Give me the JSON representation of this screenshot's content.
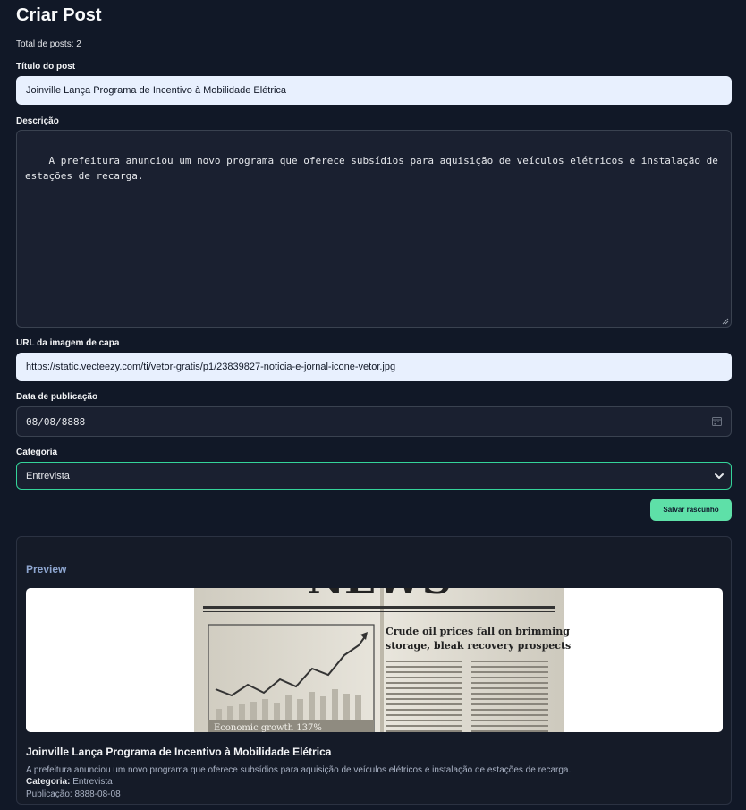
{
  "page": {
    "title": "Criar Post",
    "total_posts": "Total de posts: 2"
  },
  "form": {
    "title_label": "Título do post",
    "title_value": "Joinville Lança Programa de Incentivo à Mobilidade Elétrica",
    "description_label": "Descrição",
    "description_value": "A prefeitura anunciou um novo programa que oferece subsídios para aquisição de veículos elétricos e instalação de estações de recarga.",
    "image_url_label": "URL da imagem de capa",
    "image_url_value": "https://static.vecteezy.com/ti/vetor-gratis/p1/23839827-noticia-e-jornal-icone-vetor.jpg",
    "date_label": "Data de publicação",
    "date_value": "08/08/8888",
    "category_label": "Categoria",
    "category_value": "Entrevista",
    "save_button": "Salvar rascunho"
  },
  "preview": {
    "heading": "Preview",
    "post_title": "Joinville Lança Programa de Incentivo à Mobilidade Elétrica",
    "description": "A prefeitura anunciou um novo programa que oferece subsídios para aquisição de veículos elétricos e instalação de estações de recarga.",
    "category_label": "Categoria:",
    "category_value": "Entrevista",
    "publication_label": "Publicação:",
    "publication_value": "8888-08-08",
    "image": {
      "masthead": "NEWS",
      "headline_line1": "Crude oil prices fall on brimming",
      "headline_line2": "storage, bleak recovery prospects",
      "chart_caption": "Economic growth 137%"
    }
  },
  "colors": {
    "background": "#111827",
    "accent": "#34d399",
    "button": "#5ee0a8"
  }
}
